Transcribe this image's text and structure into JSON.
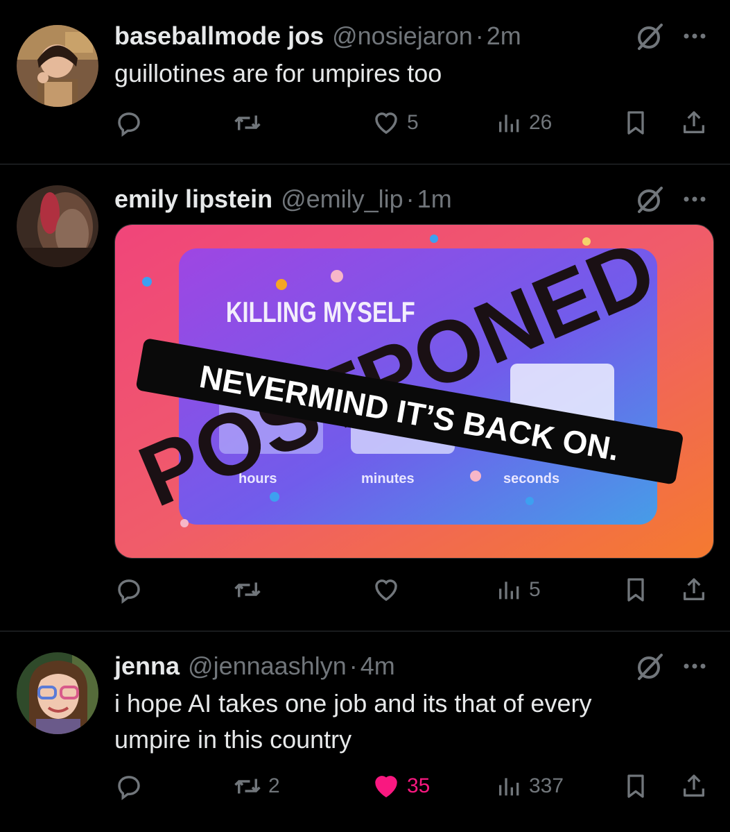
{
  "tweets": [
    {
      "name": "baseballmode jos",
      "handle": "@nosiejaron",
      "sep": "·",
      "time": "2m",
      "text": "guillotines are for umpires too",
      "replies": "",
      "retweets": "",
      "likes": "5",
      "views": "26",
      "liked": false
    },
    {
      "name": "emily lipstein",
      "handle": "@emily_lip",
      "sep": "·",
      "time": "1m",
      "text": "",
      "replies": "",
      "retweets": "",
      "likes": "",
      "views": "5",
      "liked": false,
      "media": {
        "top_label": "KILLING MYSELF",
        "stamp": "POSTPONED",
        "banner": "NEVERMIND IT’S BACK ON.",
        "units": [
          "hours",
          "minutes",
          "seconds"
        ]
      }
    },
    {
      "name": "jenna",
      "handle": "@jennaashlyn",
      "sep": "·",
      "time": "4m",
      "text_lines": [
        "i hope AI takes one job and its that of every",
        "umpire in this country"
      ],
      "replies": "",
      "retweets": "2",
      "likes": "35",
      "views": "337",
      "liked": true
    }
  ],
  "icons": {
    "reply": "reply-icon",
    "retweet": "retweet-icon",
    "like": "heart-icon",
    "views": "views-icon",
    "bookmark": "bookmark-icon",
    "share": "share-icon",
    "grok": "grok-icon",
    "more": "more-icon"
  },
  "colors": {
    "background": "#000000",
    "text": "#e7e9ea",
    "muted": "#71767b",
    "like_active": "#f91880",
    "divider": "#2f3336"
  }
}
